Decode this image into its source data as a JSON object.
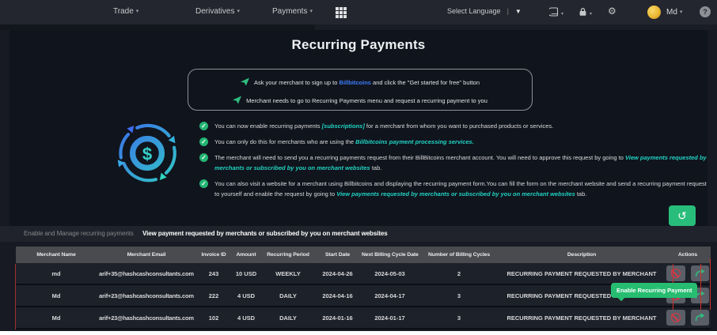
{
  "navbar": {
    "menu": [
      {
        "label": "Trade"
      },
      {
        "label": "Derivatives"
      },
      {
        "label": "Payments"
      }
    ],
    "caret": "▾",
    "language": {
      "label": "Select Language",
      "divider": "|",
      "caret": "▼"
    },
    "gear_glyph": "⚙",
    "user": {
      "name": "Md"
    },
    "help_glyph": "?"
  },
  "page": {
    "title": "Recurring Payments",
    "info_lines": [
      {
        "pre": "Ask your merchant to sign up to ",
        "link": "Billbitcoins",
        "post": " and click the \"Get started for free\" button"
      },
      {
        "pre": "Merchant needs to go to Recurring Payments menu and request a recurring payment to you",
        "link": "",
        "post": ""
      }
    ],
    "bullets": [
      {
        "pre": "You can now enable recurring payments ",
        "em": "[subscriptions]",
        "post": " for a merchant from whom you want to purchased products or services."
      },
      {
        "pre": "You can only do this for merchants who are using the ",
        "em": "Billbitcoins payment processing services.",
        "post": ""
      },
      {
        "pre": "The merchant will need to send you a recurring payments request from their BillBitcoins merchant account. You will need to approve this request by going to ",
        "em": "View payments requested by merchants or subscribed by you on merchant websites",
        "post": " tab."
      },
      {
        "pre": "You can also visit a website for a merchant using Billbitcoins and displaying the recurring payment form.You can fill the form on the merchant website and send a recurring payment request to yourself and enable the request by going to ",
        "em": "View payments requested by merchants or subscribed by you on merchant websites",
        "post": " tab."
      }
    ],
    "check_glyph": "✓",
    "dollar_glyph": "$",
    "history_glyph": "↺"
  },
  "tabs": [
    {
      "label": "Enable and Manage recurring payments",
      "active": false
    },
    {
      "label": "View payment requested by merchants or subscribed by you on merchant websites",
      "active": true
    }
  ],
  "table": {
    "headers": [
      "Merchant Name",
      "Merchant Email",
      "Invoice ID",
      "Amount",
      "Recurring Period",
      "Start Date",
      "Next Billing Cycle Date",
      "Number of Billing Cycles",
      "Description",
      "Actions"
    ],
    "rows": [
      {
        "merchant_name": "md",
        "merchant_email": "arif+35@hashcashconsultants.com",
        "invoice_id": "243",
        "amount": "10 USD",
        "recurring_period": "WEEKLY",
        "start_date": "2024-04-26",
        "next_billing_cycle_date": "2024-05-03",
        "number_of_billing_cycles": "2",
        "description": "RECURRING PAYMENT REQUESTED BY MERCHANT"
      },
      {
        "merchant_name": "Md",
        "merchant_email": "arif+23@hashcashconsultants.com",
        "invoice_id": "222",
        "amount": "4 USD",
        "recurring_period": "DAILY",
        "start_date": "2024-04-16",
        "next_billing_cycle_date": "2024-04-17",
        "number_of_billing_cycles": "3",
        "description": "RECURRING PAYMENT REQUESTED BY MERCHANT"
      },
      {
        "merchant_name": "Md",
        "merchant_email": "arif+23@hashcashconsultants.com",
        "invoice_id": "102",
        "amount": "4 USD",
        "recurring_period": "DAILY",
        "start_date": "2024-01-16",
        "next_billing_cycle_date": "2024-01-17",
        "number_of_billing_cycles": "3",
        "description": "RECURRING PAYMENT REQUESTED BY MERCHANT"
      }
    ]
  },
  "tooltip": {
    "label": "Enable Recurring Payment"
  },
  "colors": {
    "accent_green": "#29bd7b",
    "cyan": "#21d3c2",
    "link_blue": "#3e7bf7",
    "red": "#d93848",
    "gold": "#e9b52f"
  }
}
